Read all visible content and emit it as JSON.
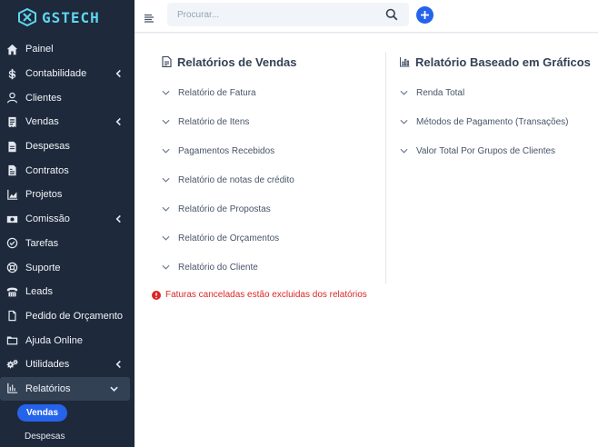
{
  "brand": {
    "name": "GSTECH",
    "color": "#5fd5ee"
  },
  "sidebar": {
    "items": [
      {
        "label": "Painel",
        "icon": "home-icon",
        "has_chevron": false
      },
      {
        "label": "Contabilidade",
        "icon": "dollar-icon",
        "has_chevron": true
      },
      {
        "label": "Clientes",
        "icon": "user-icon",
        "has_chevron": false
      },
      {
        "label": "Vendas",
        "icon": "receipt-icon",
        "has_chevron": true
      },
      {
        "label": "Despesas",
        "icon": "file-icon",
        "has_chevron": false
      },
      {
        "label": "Contratos",
        "icon": "contract-icon",
        "has_chevron": false
      },
      {
        "label": "Projetos",
        "icon": "chart-area-icon",
        "has_chevron": false
      },
      {
        "label": "Comissão",
        "icon": "money-icon",
        "has_chevron": true
      },
      {
        "label": "Tarefas",
        "icon": "check-circle-icon",
        "has_chevron": false
      },
      {
        "label": "Suporte",
        "icon": "lifebuoy-icon",
        "has_chevron": false
      },
      {
        "label": "Leads",
        "icon": "phone-icon",
        "has_chevron": false
      },
      {
        "label": "Pedido de Orçamento",
        "icon": "document-icon",
        "has_chevron": false
      },
      {
        "label": "Ajuda Online",
        "icon": "folder-icon",
        "has_chevron": false
      },
      {
        "label": "Utilidades",
        "icon": "cogs-icon",
        "has_chevron": true
      },
      {
        "label": "Relatórios",
        "icon": "chart-bar-icon",
        "has_chevron": true,
        "expanded": true
      }
    ],
    "subitems": [
      {
        "label": "Vendas",
        "active": true
      },
      {
        "label": "Despesas",
        "active": false
      }
    ]
  },
  "topbar": {
    "search_placeholder": "Procurar..."
  },
  "sales_reports": {
    "title": "Relatórios de Vendas",
    "items": [
      "Relatório de Fatura",
      "Relatório de Itens",
      "Pagamentos Recebidos",
      "Relatório de notas de crédito",
      "Relatório de Propostas",
      "Relatório de Orçamentos",
      "Relatório do Cliente"
    ],
    "warning": "Faturas canceladas estão excluidas dos relatórios"
  },
  "chart_reports": {
    "title": "Relatório Baseado em Gráficos",
    "items": [
      "Renda Total",
      "Métodos de Pagamento (Transações)",
      "Valor Total Por Grupos de Clientes"
    ]
  },
  "colors": {
    "sidebar_bg": "#1e293b",
    "accent": "#2563eb",
    "warning": "#dc2626"
  }
}
